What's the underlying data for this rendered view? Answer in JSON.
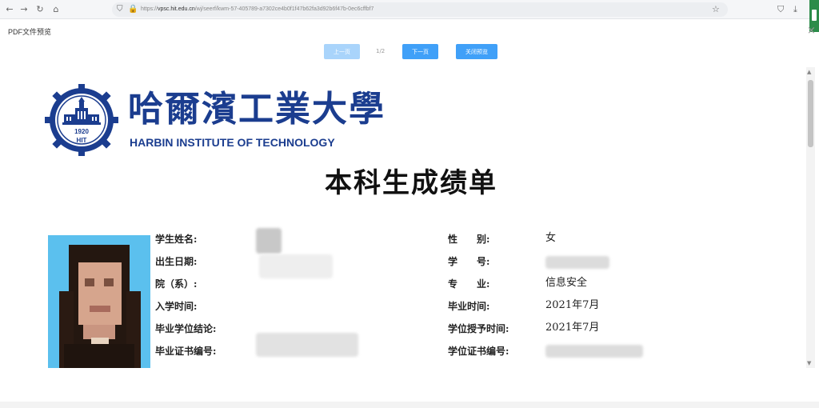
{
  "browser": {
    "url_prefix": "https://",
    "url_host": "vpsc.hit.edu.cn",
    "url_rest": "/wj/seerf/kwm-57-405789-a7302ce4b0f1f47b62fa3d92b6f47b-0ec6cffbf7"
  },
  "preview": {
    "title": "PDF文件预览",
    "prev_label": "上一页",
    "page_indicator": "1/2",
    "next_label": "下一页",
    "close_label": "关闭预览"
  },
  "document": {
    "logo_cn": "哈爾濱工業大學",
    "logo_en": "HARBIN INSTITUTE OF TECHNOLOGY",
    "logo_year": "1920",
    "logo_abbr": "HIT",
    "title": "本科生成绩单",
    "fields": [
      {
        "label": "学生姓名:",
        "value": ""
      },
      {
        "label": "出生日期:",
        "value": ""
      },
      {
        "label": "院（系）:",
        "value": ""
      },
      {
        "label": "入学时间:",
        "value": ""
      },
      {
        "label": "毕业学位结论:",
        "value": ""
      },
      {
        "label": "毕业证书编号:",
        "value": ""
      }
    ],
    "fields_right": [
      {
        "label": "性　　别:",
        "value": "女"
      },
      {
        "label": "学　　号:",
        "value": ""
      },
      {
        "label": "专　　业:",
        "value": "信息安全"
      },
      {
        "label": "毕业时间:",
        "value": "2021年7月"
      },
      {
        "label": "学位授予时间:",
        "value": "2021年7月"
      },
      {
        "label": "学位证书编号:",
        "value": ""
      }
    ]
  },
  "colors": {
    "brand_blue": "#1b3d8f",
    "button_blue": "#40a0f8",
    "button_disabled": "#a9d4fb"
  }
}
